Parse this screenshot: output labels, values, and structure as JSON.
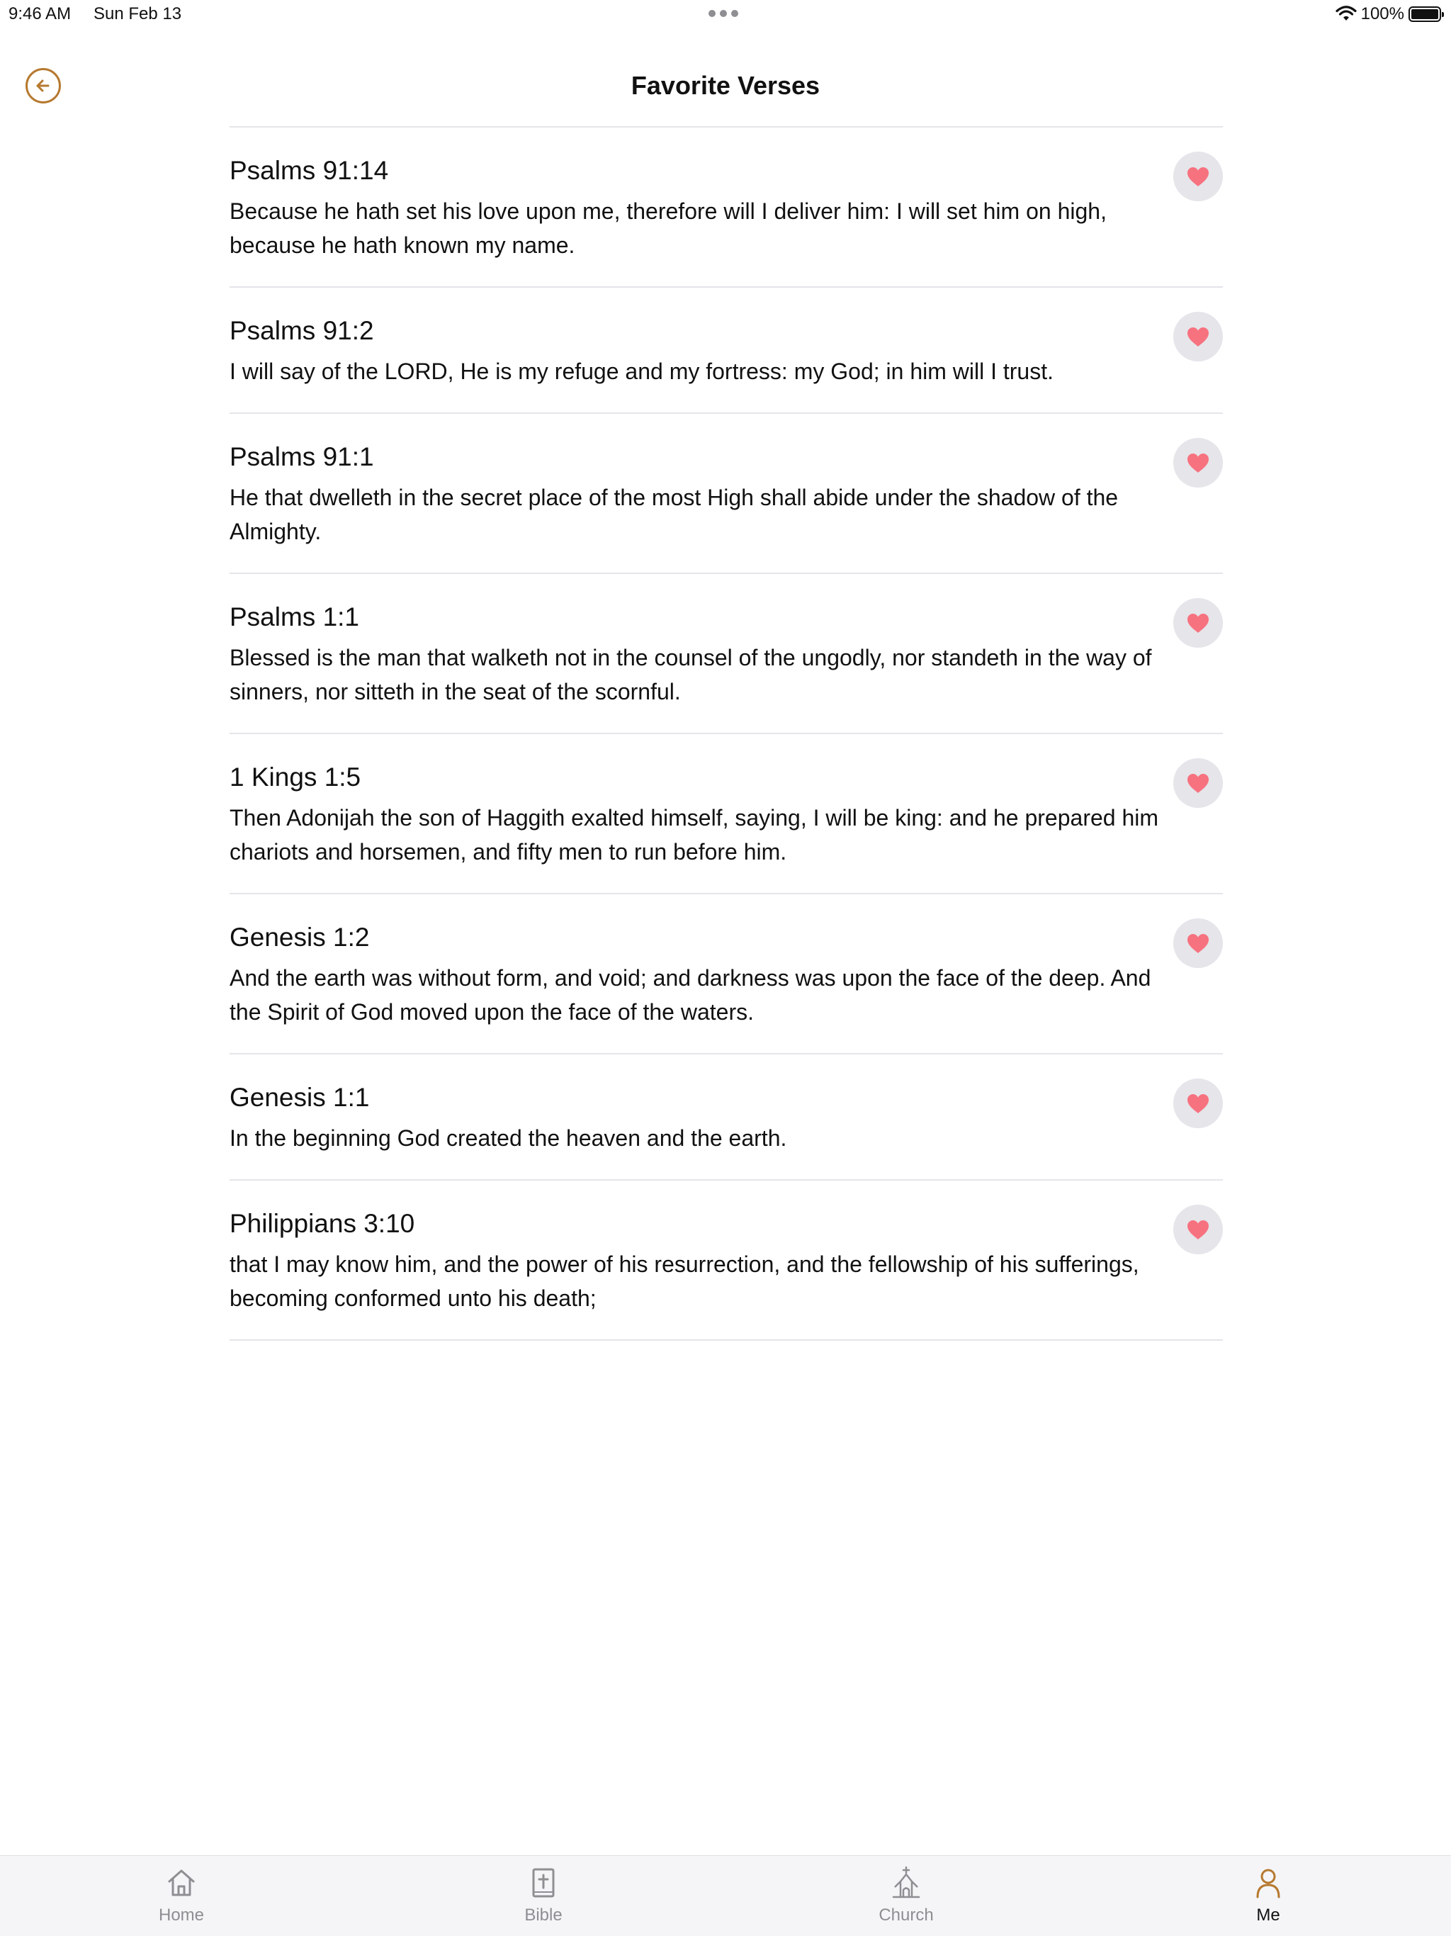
{
  "status_bar": {
    "time": "9:46 AM",
    "date": "Sun Feb 13",
    "battery_pct": "100%",
    "battery_level": 1.0
  },
  "header": {
    "title": "Favorite Verses",
    "back_icon": "arrow-left-circle-icon"
  },
  "colors": {
    "accent": "#b6792f",
    "heart": "#f7727f",
    "heart_bg": "#e5e5ea",
    "divider": "#e5e5ea",
    "tab_inactive": "#8e8e93"
  },
  "verses": [
    {
      "reference": "Psalms 91:14",
      "text": "Because he hath set his love upon me, therefore will I deliver him: I will set him on high, because he hath known my name.",
      "favorited": true
    },
    {
      "reference": "Psalms 91:2",
      "text": "I will say of the LORD, He is my refuge and my fortress: my God; in him will I trust.",
      "favorited": true
    },
    {
      "reference": "Psalms 91:1",
      "text": "He that dwelleth in the secret place of the most High shall abide under the shadow of the Almighty.",
      "favorited": true
    },
    {
      "reference": "Psalms 1:1",
      "text": "Blessed is the man that walketh not in the counsel of the ungodly, nor standeth in the way of sinners, nor sitteth in the seat of the scornful.",
      "favorited": true
    },
    {
      "reference": "1 Kings 1:5",
      "text": "Then Adonijah the son of Haggith exalted himself, saying, I will be king: and he prepared him chariots and horsemen, and fifty men to run before him.",
      "favorited": true
    },
    {
      "reference": "Genesis 1:2",
      "text": "And the earth was without form, and void; and darkness was upon the face of the deep. And the Spirit of God moved upon the face of the waters.",
      "favorited": true
    },
    {
      "reference": "Genesis 1:1",
      "text": "In the beginning God created the heaven and the earth.",
      "favorited": true
    },
    {
      "reference": "Philippians 3:10",
      "text": "that I may know him, and the power of his resurrection, and the fellowship of his sufferings, becoming conformed unto his death;",
      "favorited": true
    }
  ],
  "tab_bar": {
    "tabs": [
      {
        "label": "Home",
        "icon": "home-icon",
        "active": false
      },
      {
        "label": "Bible",
        "icon": "bible-icon",
        "active": false
      },
      {
        "label": "Church",
        "icon": "church-icon",
        "active": false
      },
      {
        "label": "Me",
        "icon": "person-icon",
        "active": true
      }
    ]
  }
}
